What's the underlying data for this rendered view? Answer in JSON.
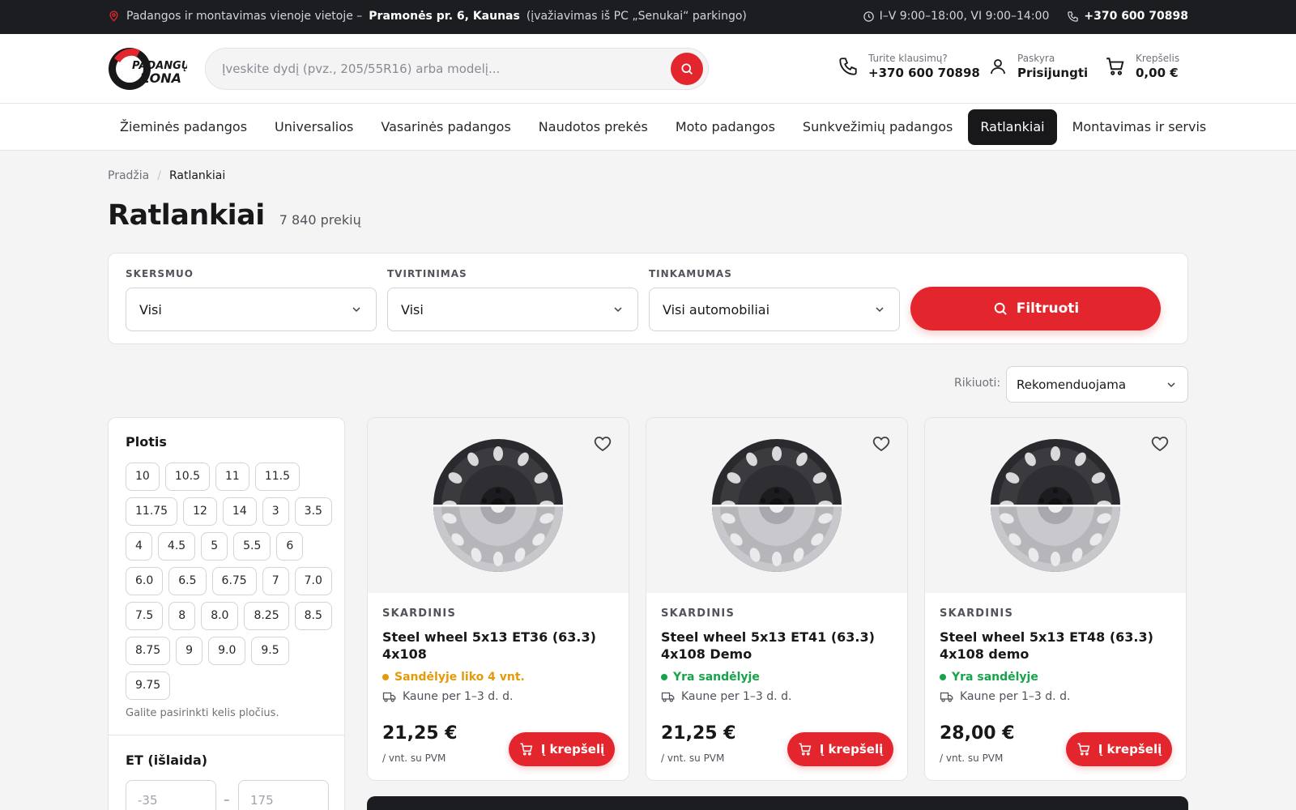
{
  "topbar": {
    "location_prefix": "Padangos ir montavimas vienoje vietoje –",
    "location_address": "Pramonės pr. 6, Kaunas",
    "location_note": "(įvažiavimas iš PC „Senukai“ parkingo)",
    "hours": "I–V 9:00–18:00, VI 9:00–14:00",
    "phone": "+370 600 70898"
  },
  "header": {
    "logo_line1": "PADANGŲ",
    "logo_line2": "ZONA",
    "search_placeholder": "Įveskite dydį (pvz., 205/55R16) arba modelį...",
    "help_label": "Turite klausimų?",
    "help_phone": "+370 600 70898",
    "account_label": "Paskyra",
    "account_action": "Prisijungti",
    "cart_label": "Krepšelis",
    "cart_total": "0,00 €"
  },
  "nav": {
    "tabs": [
      {
        "label": "Žieminės padangos"
      },
      {
        "label": "Universalios"
      },
      {
        "label": "Vasarinės padangos"
      },
      {
        "label": "Naudotos prekės"
      },
      {
        "label": "Moto padangos"
      },
      {
        "label": "Sunkvežimių padangos"
      },
      {
        "label": "Ratlankiai"
      },
      {
        "label": "Montavimas ir servisas"
      }
    ],
    "active_index": 6
  },
  "breadcrumb": {
    "home": "Pradžia",
    "separator": "/",
    "current": "Ratlankiai"
  },
  "page": {
    "title": "Ratlankiai",
    "count": "7 840 prekių"
  },
  "filters": {
    "diameter_label": "SKERSMUO",
    "diameter_value": "Visi",
    "bolt_label": "TVIRTINIMAS",
    "bolt_value": "Visi",
    "fit_label": "TINKAMUMAS",
    "fit_value": "Visi automobiliai",
    "submit_label": "Filtruoti"
  },
  "sort": {
    "label": "Rikiuoti:",
    "value": "Rekomenduojama"
  },
  "sidebar": {
    "width_title": "Plotis",
    "widths": [
      "10",
      "10.5",
      "11",
      "11.5",
      "11.75",
      "12",
      "14",
      "3",
      "3.5",
      "4",
      "4.5",
      "5",
      "5.5",
      "6",
      "6.0",
      "6.5",
      "6.75",
      "7",
      "7.0",
      "7.5",
      "8",
      "8.0",
      "8.25",
      "8.5",
      "8.75",
      "9",
      "9.0",
      "9.5",
      "9.75"
    ],
    "width_hint": "Galite pasirinkti kelis pločius.",
    "et_title": "ET (išlaida)",
    "et_min_placeholder": "-35",
    "et_dash": "–",
    "et_max_placeholder": "175"
  },
  "products": [
    {
      "brand": "SKARDINIS",
      "name": "Steel wheel 5x13 ET36 (63.3) 4x108",
      "stock": "Sandėlyje liko 4 vnt.",
      "stock_color": "#e59a0b",
      "delivery": "Kaune per 1–3 d. d.",
      "price": "21,25 €",
      "unit": "/ vnt. su PVM",
      "cart_label": "Į krepšelį"
    },
    {
      "brand": "SKARDINIS",
      "name": "Steel wheel 5x13 ET41 (63.3) 4x108 Demo",
      "stock": "Yra sandėlyje",
      "stock_color": "#16a34a",
      "delivery": "Kaune per 1–3 d. d.",
      "price": "21,25 €",
      "unit": "/ vnt. su PVM",
      "cart_label": "Į krepšelį"
    },
    {
      "brand": "SKARDINIS",
      "name": "Steel wheel 5x13 ET48 (63.3) 4x108 demo",
      "stock": "Yra sandėlyje",
      "stock_color": "#16a34a",
      "delivery": "Kaune per 1–3 d. d.",
      "price": "28,00 €",
      "unit": "/ vnt. su PVM",
      "cart_label": "Į krepšelį"
    }
  ],
  "colors": {
    "accent": "#e3262d",
    "dark": "#1c1d21"
  },
  "icons": [
    "map-pin-icon",
    "clock-icon",
    "phone-icon",
    "search-icon",
    "user-icon",
    "cart-icon",
    "chevron-down-icon",
    "heart-icon",
    "truck-icon"
  ]
}
